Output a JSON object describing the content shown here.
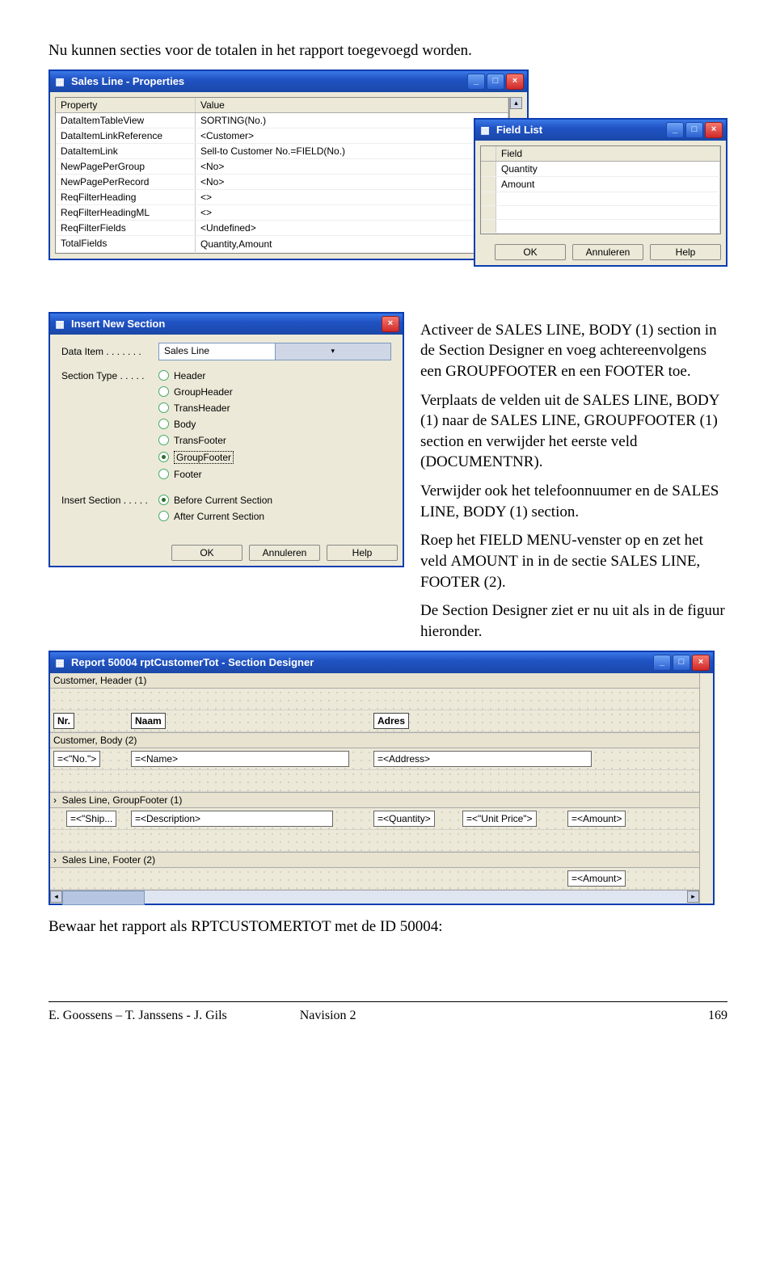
{
  "text": {
    "intro": "Nu kunnen secties voor de totalen in het rapport toegevoegd worden.",
    "p1a": "Activeer de ",
    "p1b": " section in de Section Designer en voeg achtereenvolgens een ",
    "p1c": " en een ",
    "p1d": " toe.",
    "p2a": "Verplaats de velden uit de ",
    "p2b": " naar de ",
    "p2c": " section en verwijder het eerste veld (",
    "p2d": ").",
    "p3a": "Verwijder ook het telefoonnuumer en de ",
    "p3b": " section.",
    "p4a": "Roep het ",
    "p4b": "-venster op en zet het veld ",
    "p4c": " in in de sectie ",
    "p4d": ".",
    "p5": "De Section Designer ziet er nu uit als in de figuur hieronder.",
    "bottom": "Bewaar het rapport als RPTCUSTOMERTOT met de ID 50004:",
    "tokens": {
      "salesLineBody1": "SALES LINE, BODY (1)",
      "groupfooter": "GROUPFOOTER",
      "footer": "FOOTER",
      "groupfooter1": "SALES LINE, GROUPFOOTER (1)",
      "documentnr": "DOCUMENTNR",
      "fieldMenu": "FIELD MENU",
      "amount": "AMOUNT",
      "salesLineFooter2": "SALES LINE, FOOTER (2)"
    }
  },
  "propsWin": {
    "title": "Sales Line - Properties",
    "headers": {
      "c1": "Property",
      "c2": "Value"
    },
    "rows": [
      {
        "p": "DataItemTableView",
        "v": "SORTING(No.)"
      },
      {
        "p": "DataItemLinkReference",
        "v": "<Customer>"
      },
      {
        "p": "DataItemLink",
        "v": "Sell-to Customer No.=FIELD(No.)"
      },
      {
        "p": "NewPagePerGroup",
        "v": "<No>"
      },
      {
        "p": "NewPagePerRecord",
        "v": "<No>"
      },
      {
        "p": "ReqFilterHeading",
        "v": "<>"
      },
      {
        "p": "ReqFilterHeadingML",
        "v": "<>"
      },
      {
        "p": "ReqFilterFields",
        "v": "<Undefined>"
      },
      {
        "p": "TotalFields",
        "v": "Quantity,Amount"
      }
    ]
  },
  "fieldList": {
    "title": "Field List",
    "header": "Field",
    "rows": [
      "Quantity",
      "Amount"
    ],
    "buttons": {
      "ok": "OK",
      "cancel": "Annuleren",
      "help": "Help"
    }
  },
  "insert": {
    "title": "Insert New Section",
    "dataItemLabel": "Data Item . . . . . . .",
    "dataItemValue": "Sales Line",
    "sectionTypeLabel": "Section Type  . . . . .",
    "types": [
      "Header",
      "GroupHeader",
      "TransHeader",
      "Body",
      "TransFooter",
      "GroupFooter",
      "Footer"
    ],
    "typeSelectedIndex": 5,
    "insertSectionLabel": "Insert Section . . . . .",
    "positions": [
      "Before Current Section",
      "After Current Section"
    ],
    "posSelectedIndex": 0,
    "buttons": {
      "ok": "OK",
      "cancel": "Annuleren",
      "help": "Help"
    }
  },
  "sectionDesigner": {
    "title": "Report 50004 rptCustomerTot - Section Designer",
    "sections": {
      "s1": "Customer, Header (1)",
      "s2": "Customer, Body (2)",
      "s3": "Sales Line, GroupFooter (1)",
      "s4": "Sales Line, Footer (2)"
    },
    "labels": {
      "nr": "Nr.",
      "naam": "Naam",
      "adres": "Adres",
      "noField": "=<\"No.\">",
      "nameField": "=<Name>",
      "addressField": "=<Address>",
      "shipField": "=<\"Ship...",
      "descField": "=<Description>",
      "qtyField": "=<Quantity>",
      "unitField": "=<\"Unit Price\">",
      "amountField": "=<Amount>"
    }
  },
  "footer": {
    "authors": "E. Goossens – T. Janssens - J. Gils",
    "course": "Navision 2",
    "page": "169"
  }
}
